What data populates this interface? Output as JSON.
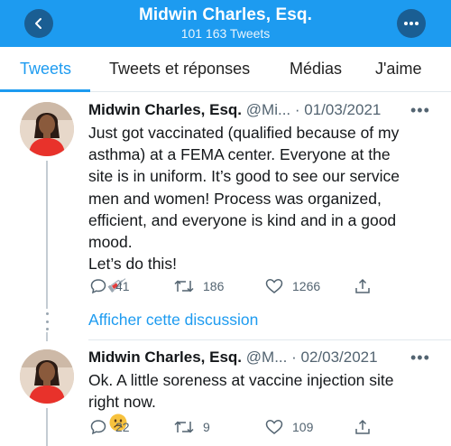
{
  "header": {
    "title": "Midwin Charles, Esq.",
    "subtitle": "101 163 Tweets",
    "accent": "#1d9bf0"
  },
  "tabs": [
    {
      "label": "Tweets",
      "active": true
    },
    {
      "label": "Tweets et réponses",
      "active": false
    },
    {
      "label": "Médias",
      "active": false
    },
    {
      "label": "J'aime",
      "active": false
    }
  ],
  "tweets": [
    {
      "name": "Midwin Charles, Esq.",
      "handle": "@Mi...",
      "date": "· 01/03/2021",
      "lines": [
        "Just got vaccinated (qualified because of my",
        "asthma) at a FEMA center. Everyone at the",
        "site is in uniform. It’s good to see our service",
        "men and women! Process was organized,",
        "efficient, and everyone is kind and in a good",
        "mood.",
        "Let’s do this!"
      ],
      "emoji": "syringe-emoji",
      "stats": {
        "replies": "41",
        "retweets": "186",
        "likes": "1266"
      }
    },
    {
      "name": "Midwin Charles, Esq.",
      "handle": "@M...",
      "date": "· 02/03/2021",
      "lines": [
        "Ok. A little soreness at vaccine injection site",
        "right now."
      ],
      "emoji": "frowning-face-emoji",
      "stats": {
        "replies": "22",
        "retweets": "9",
        "likes": "109"
      }
    }
  ],
  "show_thread": "Afficher cette discussion",
  "more_glyph": "•••",
  "icons": [
    "back-arrow-icon",
    "more-icon",
    "reply-icon",
    "retweet-icon",
    "like-icon",
    "share-icon"
  ]
}
